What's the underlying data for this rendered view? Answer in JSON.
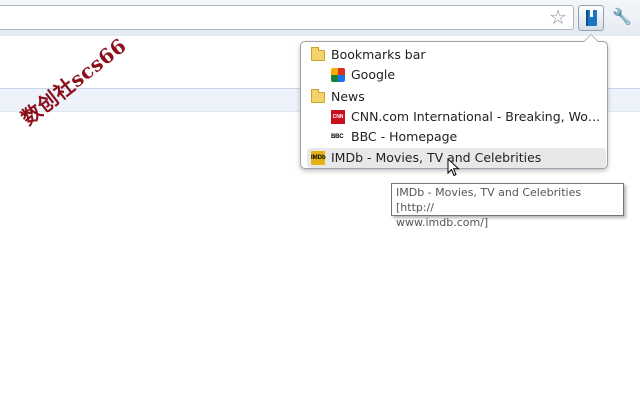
{
  "watermark": "数创社scs66",
  "toolbar": {
    "star_icon": "star-icon",
    "extension_icon": "bookmark-extension-icon",
    "wrench_icon": "wrench-icon"
  },
  "popup": {
    "items": [
      {
        "type": "folder",
        "label": "Bookmarks bar",
        "icon": "folder-icon"
      },
      {
        "type": "bookmark",
        "label": "Google",
        "icon": "google-favicon"
      },
      {
        "type": "folder",
        "label": "News",
        "icon": "folder-icon"
      },
      {
        "type": "bookmark",
        "label": "CNN.com International - Breaking, World...",
        "icon": "cnn-favicon",
        "icon_text": "CNN"
      },
      {
        "type": "bookmark",
        "label": "BBC - Homepage",
        "icon": "bbc-favicon",
        "icon_text": "BBC"
      },
      {
        "type": "bookmark",
        "label": "IMDb - Movies, TV and Celebrities",
        "icon": "imdb-favicon",
        "icon_text": "IMDb",
        "hovered": true
      }
    ]
  },
  "tooltip": {
    "text": "IMDb - Movies, TV and Celebrities [http://\nwww.imdb.com/]"
  }
}
